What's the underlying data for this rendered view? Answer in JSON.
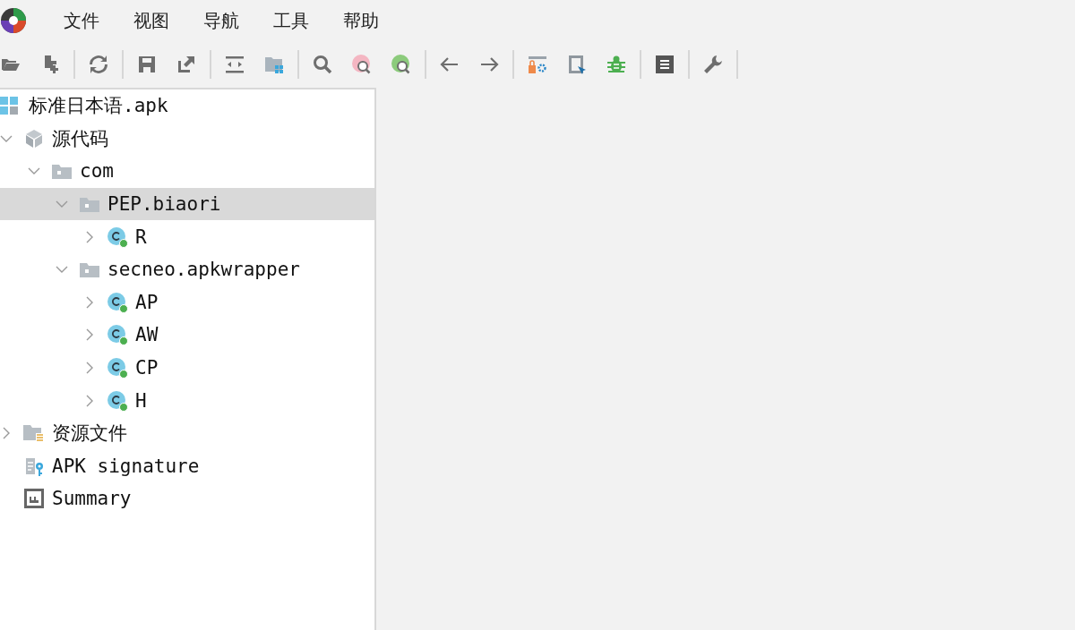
{
  "menu_bar": {
    "items": [
      {
        "label": "文件"
      },
      {
        "label": "视图"
      },
      {
        "label": "导航"
      },
      {
        "label": "工具"
      },
      {
        "label": "帮助"
      }
    ]
  },
  "tree": [
    {
      "label": "标准日本语.apk",
      "kind": "apk",
      "selected": false,
      "children": [
        {
          "label": "源代码",
          "kind": "source",
          "expanded": true,
          "selected": false,
          "children": [
            {
              "label": "com",
              "kind": "package",
              "expanded": true,
              "selected": false,
              "children": [
                {
                  "label": "PEP.biaori",
                  "kind": "package",
                  "expanded": true,
                  "selected": true,
                  "children": [
                    {
                      "label": "R",
                      "kind": "class",
                      "expanded": false,
                      "selected": false
                    }
                  ]
                },
                {
                  "label": "secneo.apkwrapper",
                  "kind": "package",
                  "expanded": true,
                  "selected": false,
                  "children": [
                    {
                      "label": "AP",
                      "kind": "class",
                      "expanded": false,
                      "selected": false
                    },
                    {
                      "label": "AW",
                      "kind": "class",
                      "expanded": false,
                      "selected": false
                    },
                    {
                      "label": "CP",
                      "kind": "class",
                      "expanded": false,
                      "selected": false
                    },
                    {
                      "label": "H",
                      "kind": "class",
                      "expanded": false,
                      "selected": false
                    }
                  ]
                }
              ]
            }
          ]
        },
        {
          "label": "资源文件",
          "kind": "resources",
          "expanded": false,
          "selected": false
        },
        {
          "label": "APK signature",
          "kind": "signature",
          "selected": false
        },
        {
          "label": "Summary",
          "kind": "summary",
          "selected": false
        }
      ]
    }
  ]
}
